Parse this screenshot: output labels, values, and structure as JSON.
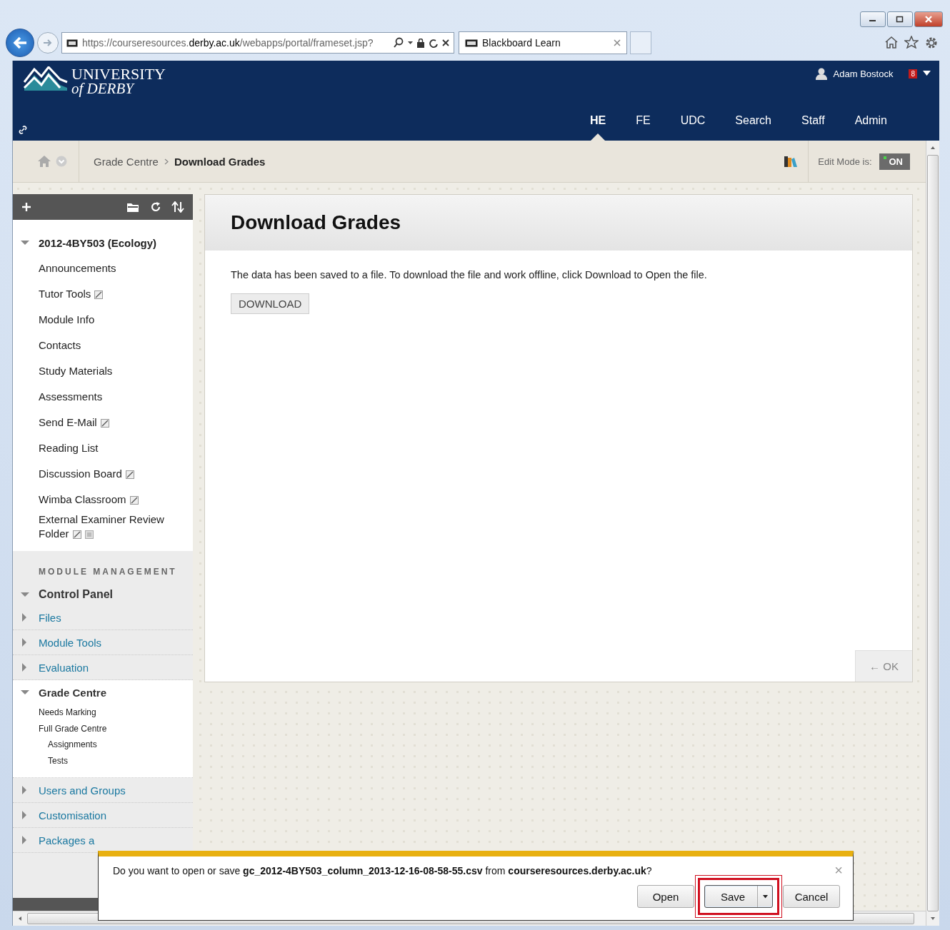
{
  "browser": {
    "address": "https://courseresources.**derby.ac.uk**/webapps/portal/frameset.jsp?",
    "tab_title": "Blackboard Learn"
  },
  "header": {
    "logo_line1": "UNIVERSITY",
    "logo_line2": "of DERBY",
    "user": "Adam Bostock",
    "notifications": "8",
    "nav": [
      {
        "label": "HE",
        "selected": true
      },
      {
        "label": "FE",
        "selected": false
      },
      {
        "label": "UDC",
        "selected": false
      },
      {
        "label": "Search",
        "selected": false
      },
      {
        "label": "Staff",
        "selected": false
      },
      {
        "label": "Admin",
        "selected": false
      }
    ]
  },
  "breadcrumb": {
    "items": [
      "Grade Centre",
      "Download Grades"
    ],
    "edit_mode_label": "Edit Mode is:",
    "edit_mode": {
      "label": "ON",
      "on": true
    }
  },
  "sidebar": {
    "course": {
      "title": "2012-4BY503 (Ecology)",
      "expanded": true
    },
    "items": [
      {
        "label": "Announcements",
        "hidden": false
      },
      {
        "label": "Tutor Tools",
        "hidden": true
      },
      {
        "label": "Module Info",
        "hidden": false
      },
      {
        "label": "Contacts",
        "hidden": false
      },
      {
        "label": "Study Materials",
        "hidden": false
      },
      {
        "label": "Assessments",
        "hidden": false
      },
      {
        "label": "Send E-Mail",
        "hidden": true
      },
      {
        "label": "Reading List",
        "hidden": false
      },
      {
        "label": "Discussion Board",
        "hidden": true
      },
      {
        "label": "Wimba Classroom",
        "hidden": true
      },
      {
        "label": "External Examiner Review Folder",
        "hidden": true,
        "tracked": true
      }
    ],
    "management_heading": "MODULE MANAGEMENT",
    "control_panel": {
      "title": "Control Panel",
      "expanded": true
    },
    "sections": [
      {
        "label": "Files",
        "expanded": false
      },
      {
        "label": "Module Tools",
        "expanded": false
      },
      {
        "label": "Evaluation",
        "expanded": false
      },
      {
        "label": "Grade Centre",
        "expanded": true,
        "children": [
          {
            "label": "Needs Marking"
          },
          {
            "label": "Full Grade Centre",
            "children": [
              {
                "label": "Assignments"
              },
              {
                "label": "Tests"
              }
            ]
          }
        ]
      },
      {
        "label": "Users and Groups",
        "expanded": false
      },
      {
        "label": "Customisation",
        "expanded": false
      },
      {
        "label": "Packages a",
        "expanded": false
      }
    ]
  },
  "content": {
    "title": "Download Grades",
    "message": "The data has been saved to a file. To download the file and work offline, click Download to Open the file.",
    "download_button": "DOWNLOAD",
    "ok_button": "← OK"
  },
  "download_bar": {
    "message": "Do you want to open or save **gc_2012-4BY503_column_2013-12-16-08-58-55.csv** from **courseresources.derby.ac.uk**?",
    "buttons": [
      {
        "label": "Open",
        "highlighted": false,
        "split": false
      },
      {
        "label": "Save",
        "highlighted": true,
        "split": true
      },
      {
        "label": "Cancel",
        "highlighted": false,
        "split": false
      }
    ],
    "close": "×"
  }
}
